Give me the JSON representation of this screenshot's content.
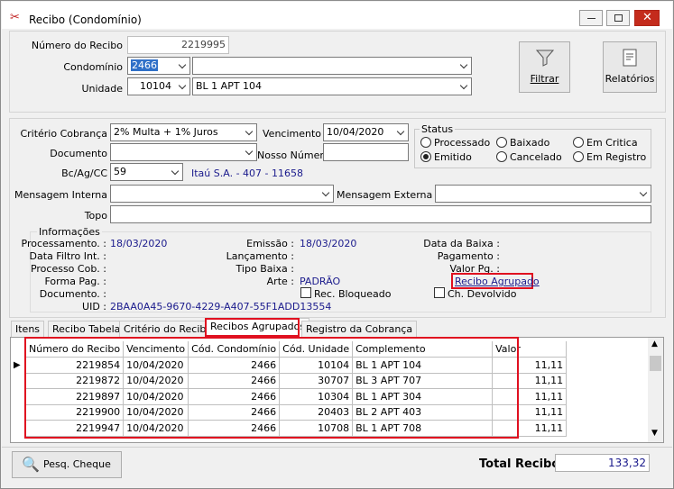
{
  "window": {
    "title": "Recibo (Condomínio)"
  },
  "header": {
    "numero_recibo_label": "Número do Recibo",
    "numero_recibo": "2219995",
    "condominio_label": "Condomínio",
    "condominio_code": "2466",
    "condominio_name": "",
    "unidade_label": "Unidade",
    "unidade_code": "10104",
    "unidade_name": "BL 1 APT 104",
    "filtrar": "Filtrar",
    "relatorios": "Relatórios"
  },
  "form": {
    "criterio_label": "Critério Cobrança",
    "criterio": "2% Multa + 1% Juros",
    "vencimento_label": "Vencimento",
    "vencimento": "10/04/2020",
    "documento_label": "Documento",
    "documento": "",
    "nosso_numero_label": "Nosso Número",
    "nosso_numero": "",
    "bc_label": "Bc/Ag/CC",
    "bc": "59",
    "bank_info": "Itaú S.A. - 407 - 11658",
    "msg_interna_label": "Mensagem Interna",
    "msg_interna": "",
    "msg_externa_label": "Mensagem Externa",
    "msg_externa": "",
    "topo_label": "Topo",
    "topo": ""
  },
  "status": {
    "title": "Status",
    "options": [
      "Processado",
      "Baixado",
      "Em Critica",
      "Emitido",
      "Cancelado",
      "Em Registro"
    ],
    "selected": "Emitido"
  },
  "info": {
    "title": "Informações",
    "processamento_label": "Processamento. :",
    "processamento": "18/03/2020",
    "emissao_label": "Emissão :",
    "emissao": "18/03/2020",
    "data_baixa_label": "Data da Baixa :",
    "data_filtro_label": "Data Filtro Int. :",
    "lancamento_label": "Lançamento :",
    "pagamento_label": "Pagamento :",
    "processo_cob_label": "Processo Cob. :",
    "tipo_baixa_label": "Tipo Baixa :",
    "valor_pg_label": "Valor Pg. :",
    "forma_pag_label": "Forma Pag. :",
    "arte_label": "Arte :",
    "arte": "PADRÃO",
    "recibo_agrupado": "Recibo Agrupado",
    "documento_label": "Documento. :",
    "rec_bloqueado": "Rec. Bloqueado",
    "ch_devolvido": "Ch. Devolvido",
    "uid_label": "UID :",
    "uid": "2BAA0A45-9670-4229-A407-55F1ADD13554"
  },
  "tabs": [
    "Itens",
    "Recibo Tabela",
    "Critério do Recibo",
    "Recibos Agrupados",
    "Registro da Cobrança"
  ],
  "grid": {
    "columns": [
      "Número do Recibo",
      "Vencimento",
      "Cód. Condomínio",
      "Cód. Unidade",
      "Complemento",
      "Valor"
    ],
    "rows": [
      [
        "2219854",
        "10/04/2020",
        "2466",
        "10104",
        "BL 1 APT 104",
        "11,11"
      ],
      [
        "2219872",
        "10/04/2020",
        "2466",
        "30707",
        "BL 3 APT 707",
        "11,11"
      ],
      [
        "2219897",
        "10/04/2020",
        "2466",
        "10304",
        "BL 1 APT 304",
        "11,11"
      ],
      [
        "2219900",
        "10/04/2020",
        "2466",
        "20403",
        "BL 2 APT 403",
        "11,11"
      ],
      [
        "2219947",
        "10/04/2020",
        "2466",
        "10708",
        "BL 1 APT 708",
        "11,11"
      ]
    ]
  },
  "footer": {
    "pesq_cheque": "Pesq. Cheque",
    "total_label": "Total Recibo",
    "total": "133,32"
  },
  "colors": {
    "accent_red": "#e01020",
    "link_blue": "#1a1a8c",
    "close_red": "#c42b1c"
  }
}
